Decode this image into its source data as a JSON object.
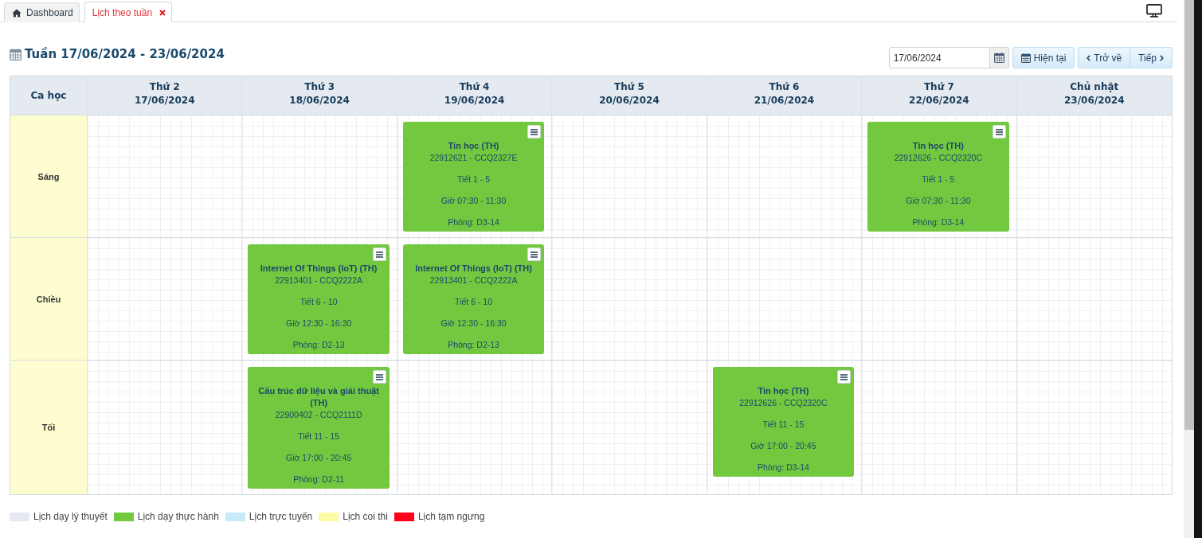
{
  "tabs": [
    {
      "label": "Dashboard",
      "kind": "home",
      "selected": false
    },
    {
      "label": "Lịch theo tuần",
      "kind": "page",
      "selected": true
    }
  ],
  "toolbar": {
    "title": "Tuần 17/06/2024 - 23/06/2024",
    "date_field": {
      "value": "17/06/2024"
    },
    "buttons": [
      {
        "label": "Hiện tại",
        "kind": "today"
      },
      {
        "label": "Trở về",
        "kind": "prev"
      },
      {
        "label": "Tiếp",
        "kind": "next"
      }
    ]
  },
  "table": {
    "corner": "Ca học",
    "columns": [
      {
        "day": "Thứ 2",
        "date": "17/06/2024"
      },
      {
        "day": "Thứ 3",
        "date": "18/06/2024"
      },
      {
        "day": "Thứ 4",
        "date": "19/06/2024"
      },
      {
        "day": "Thứ 5",
        "date": "20/06/2024"
      },
      {
        "day": "Thứ 6",
        "date": "21/06/2024"
      },
      {
        "day": "Thứ 7",
        "date": "22/06/2024"
      },
      {
        "day": "Chủ nhật",
        "date": "23/06/2024"
      }
    ],
    "rows": [
      {
        "session": "Sáng",
        "cells": [
          null,
          null,
          {
            "title": "Tin học (TH)",
            "code": "22912621 - CCQ2327E",
            "periods": "Tiết 1 - 5",
            "time": "Giờ 07:30 - 11:30",
            "room": "Phòng: D3-14",
            "color": "#72c940"
          },
          null,
          null,
          {
            "title": "Tin học (TH)",
            "code": "22912626 - CCQ2320C",
            "periods": "Tiết 1 - 5",
            "time": "Giờ 07:30 - 11:30",
            "room": "Phòng: D3-14",
            "color": "#72c940"
          },
          null
        ]
      },
      {
        "session": "Chiều",
        "cells": [
          null,
          {
            "title": "Internet Of Things (IoT) (TH)",
            "code": "22913401 - CCQ2222A",
            "periods": "Tiết 6 - 10",
            "time": "Giờ 12:30 - 16:30",
            "room": "Phòng: D2-13",
            "color": "#72c940"
          },
          {
            "title": "Internet Of Things (IoT) (TH)",
            "code": "22913401 - CCQ2222A",
            "periods": "Tiết 6 - 10",
            "time": "Giờ 12:30 - 16:30",
            "room": "Phòng: D2-13",
            "color": "#72c940"
          },
          null,
          null,
          null,
          null
        ]
      },
      {
        "session": "Tối",
        "cells": [
          null,
          {
            "title": "Cấu trúc dữ liệu và giải thuật (TH)",
            "code": "22900402 - CCQ2111D",
            "periods": "Tiết 11 - 15",
            "time": "Giờ 17:00 - 20:45",
            "room": "Phòng: D2-11",
            "color": "#72c940"
          },
          null,
          null,
          {
            "title": "Tin học (TH)",
            "code": "22912626 - CCQ2320C",
            "periods": "Tiết 11 - 15",
            "time": "Giờ 17:00 - 20:45",
            "room": "Phòng: D3-14",
            "color": "#72c940"
          },
          null,
          null
        ]
      }
    ]
  },
  "legend": [
    {
      "label": "Lịch dạy lý thuyết",
      "color": "#e4e9f2"
    },
    {
      "label": "Lịch dạy thực hành",
      "color": "#72c940"
    },
    {
      "label": "Lịch trực tuyến",
      "color": "#c6eafa"
    },
    {
      "label": "Lịch coi thi",
      "color": "#fdfca6"
    },
    {
      "label": "Lịch tạm ngưng",
      "color": "#ff0018"
    }
  ]
}
